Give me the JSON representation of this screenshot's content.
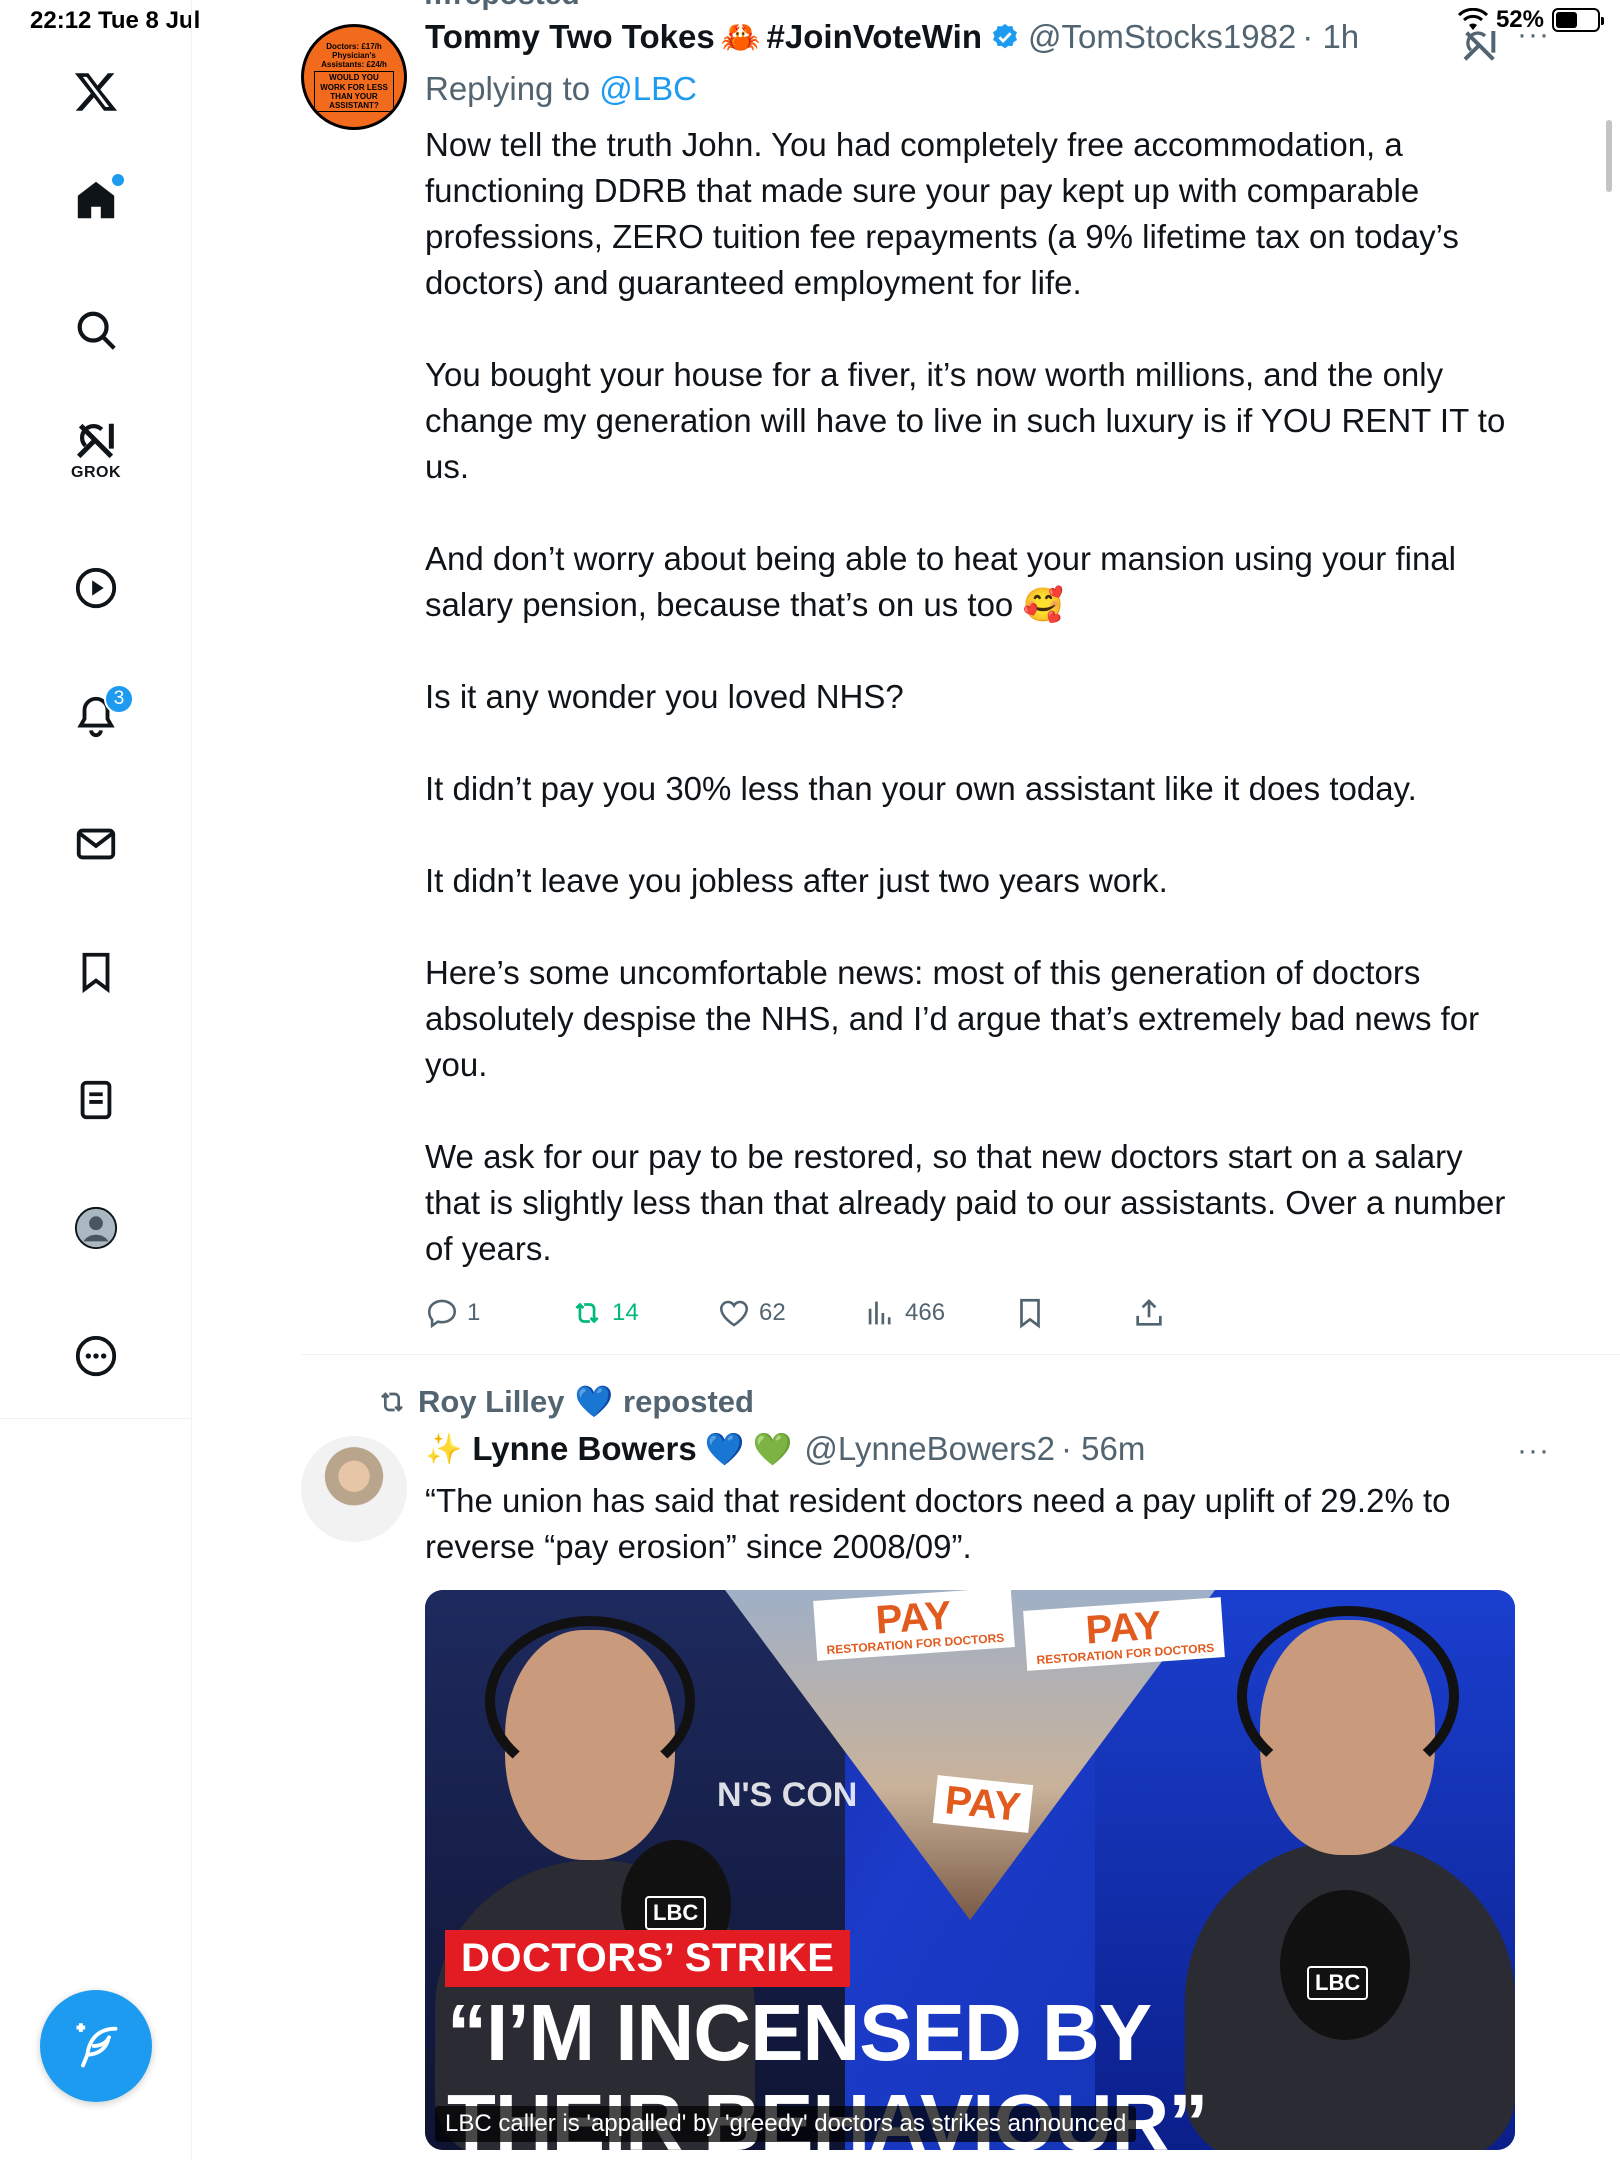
{
  "status_bar": {
    "time": "22:12",
    "date": "Tue 8 Jul",
    "battery": "52%",
    "battery_level": 0.52
  },
  "sidebar": {
    "grok_label": "GROK",
    "notifications_badge": "3",
    "items": [
      "home",
      "search",
      "grok",
      "video",
      "notifications",
      "messages",
      "bookmarks",
      "lists",
      "profile",
      "more"
    ]
  },
  "colors": {
    "accent": "#1d9bf0",
    "repost_green": "#00ba7c",
    "secondary_text": "#536471",
    "strap_red": "#e31b23"
  },
  "feed": {
    "top_cut_text": "…reposted",
    "tweet1": {
      "author_name": "Tommy Two Tokes",
      "name_emoji": "🦀",
      "hashtag": "#JoinVoteWin",
      "handle": "@TomStocks1982",
      "time": "· 1h",
      "replying_prefix": "Replying to ",
      "replying_to": "@LBC",
      "avatar_text": "Doctors: £17/h Physician's Assistants: £24/h",
      "avatar_box": "WOULD YOU WORK FOR LESS THAN YOUR ASSISTANT?",
      "paragraphs": [
        "Now tell the truth John. You had completely free accommodation, a functioning DDRB that made sure your pay kept up with comparable professions, ZERO tuition fee repayments (a 9% lifetime tax on today’s doctors) and guaranteed employment for life.",
        "You bought your house for a fiver, it’s now worth millions, and the only change my generation will have to live in such luxury is if YOU RENT IT to us.",
        "And don’t worry about being able to heat your mansion using your final salary pension, because that’s on us too 🥰",
        "Is it any wonder you loved NHS?",
        "It didn’t pay you 30% less than your own assistant like it does today.",
        "It didn’t leave you jobless after just two years work.",
        "Here’s some uncomfortable news: most of this generation of doctors absolutely despise the NHS, and I’d argue that’s extremely bad news for you.",
        "We ask for our pay to be restored, so that new doctors start on a salary that is slightly less than that already paid to our assistants. Over a number of years."
      ],
      "actions": {
        "replies": "1",
        "reposts": "14",
        "likes": "62",
        "views": "466"
      }
    },
    "tweet2": {
      "reposted_by": "Roy Lilley",
      "reposted_heart": "💙",
      "reposted_label": "reposted",
      "sparkle": "✨",
      "author_name": "Lynne Bowers",
      "heart_blue": "💙",
      "heart_green": "💚",
      "handle": "@LynneBowers2",
      "time": "· 56m",
      "text": "“The union has said that resident doctors need a pay uplift of 29.2% to reverse “pay erosion” since 2008/09”.",
      "media": {
        "strap": "DOCTORS’ STRIKE",
        "headline_line1": "“I’M INCENSED BY",
        "headline_line2": "THEIR BEHAVIOUR”",
        "caption": "LBC caller is 'appalled' by 'greedy' doctors as strikes announced",
        "placard_word": "PAY",
        "placard_sub": "RESTORATION FOR DOCTORS",
        "lbc": "LBC",
        "backdrop_text": "N'S CON"
      }
    }
  }
}
